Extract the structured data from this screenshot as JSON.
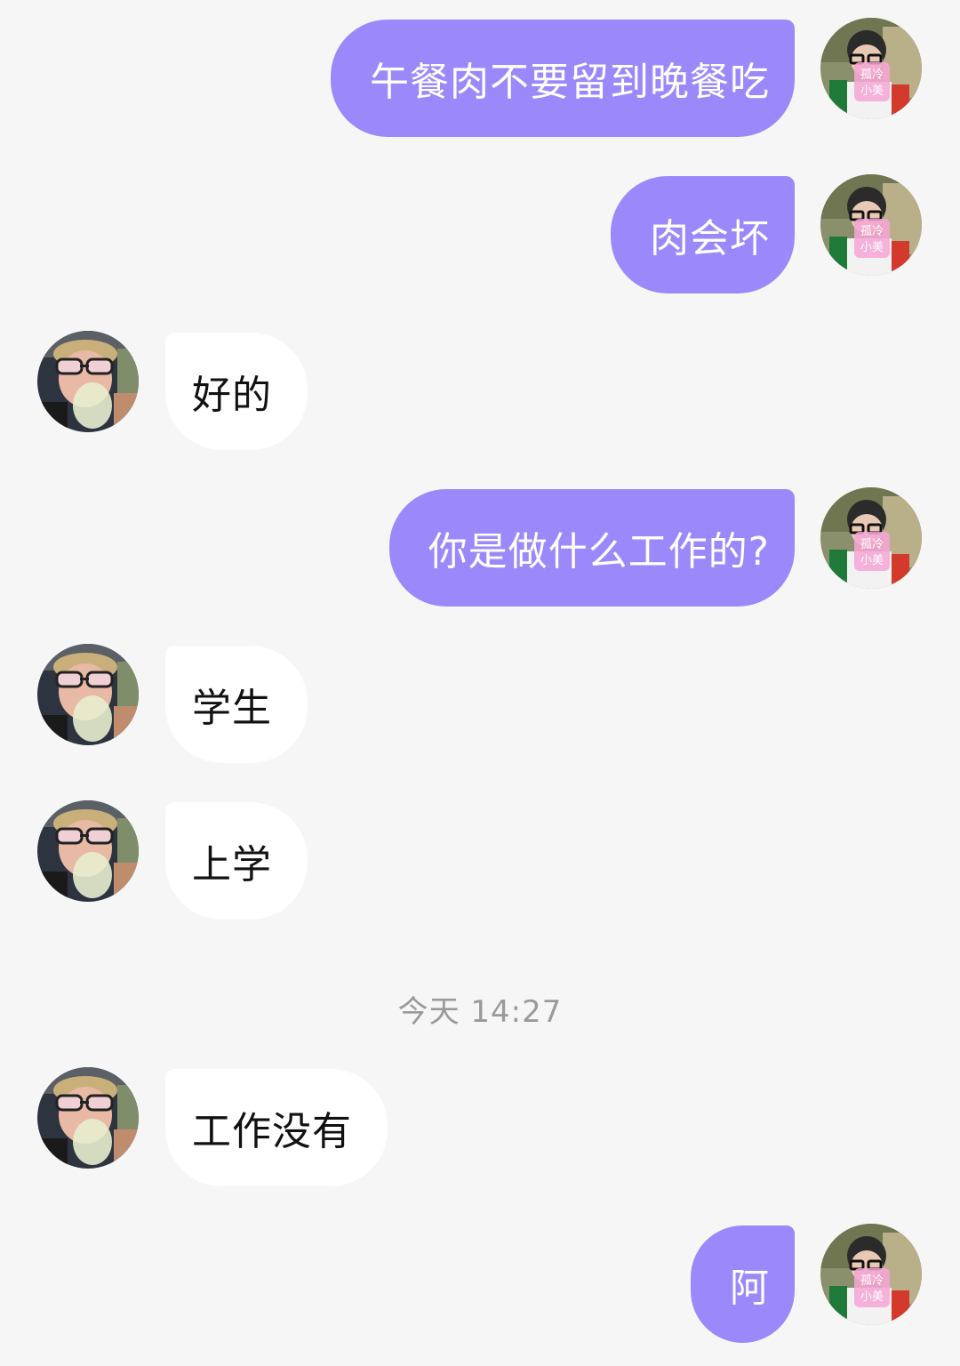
{
  "colors": {
    "background": "#f6f6f6",
    "outgoing_bubble": "#9b89fb",
    "incoming_bubble": "#ffffff",
    "timestamp_text": "#9a9a9a"
  },
  "messages": [
    {
      "direction": "out",
      "text": "午餐肉不要留到晚餐吃",
      "avatar": "self-avatar-badge"
    },
    {
      "direction": "out",
      "text": "肉会坏",
      "avatar": "self-avatar-badge"
    },
    {
      "direction": "in",
      "text": "好的",
      "avatar": "contact-avatar-glasses"
    },
    {
      "direction": "out",
      "text": "你是做什么工作的?",
      "avatar": "self-avatar-badge"
    },
    {
      "direction": "in",
      "text": "学生",
      "avatar": "contact-avatar-glasses"
    },
    {
      "direction": "in",
      "text": "上学",
      "avatar": "contact-avatar-glasses"
    },
    {
      "direction": "in",
      "text": "工作没有",
      "avatar": "contact-avatar-glasses"
    },
    {
      "direction": "out",
      "text": "阿",
      "avatar": "self-avatar-badge"
    }
  ],
  "timestamp": "今天 14:27"
}
